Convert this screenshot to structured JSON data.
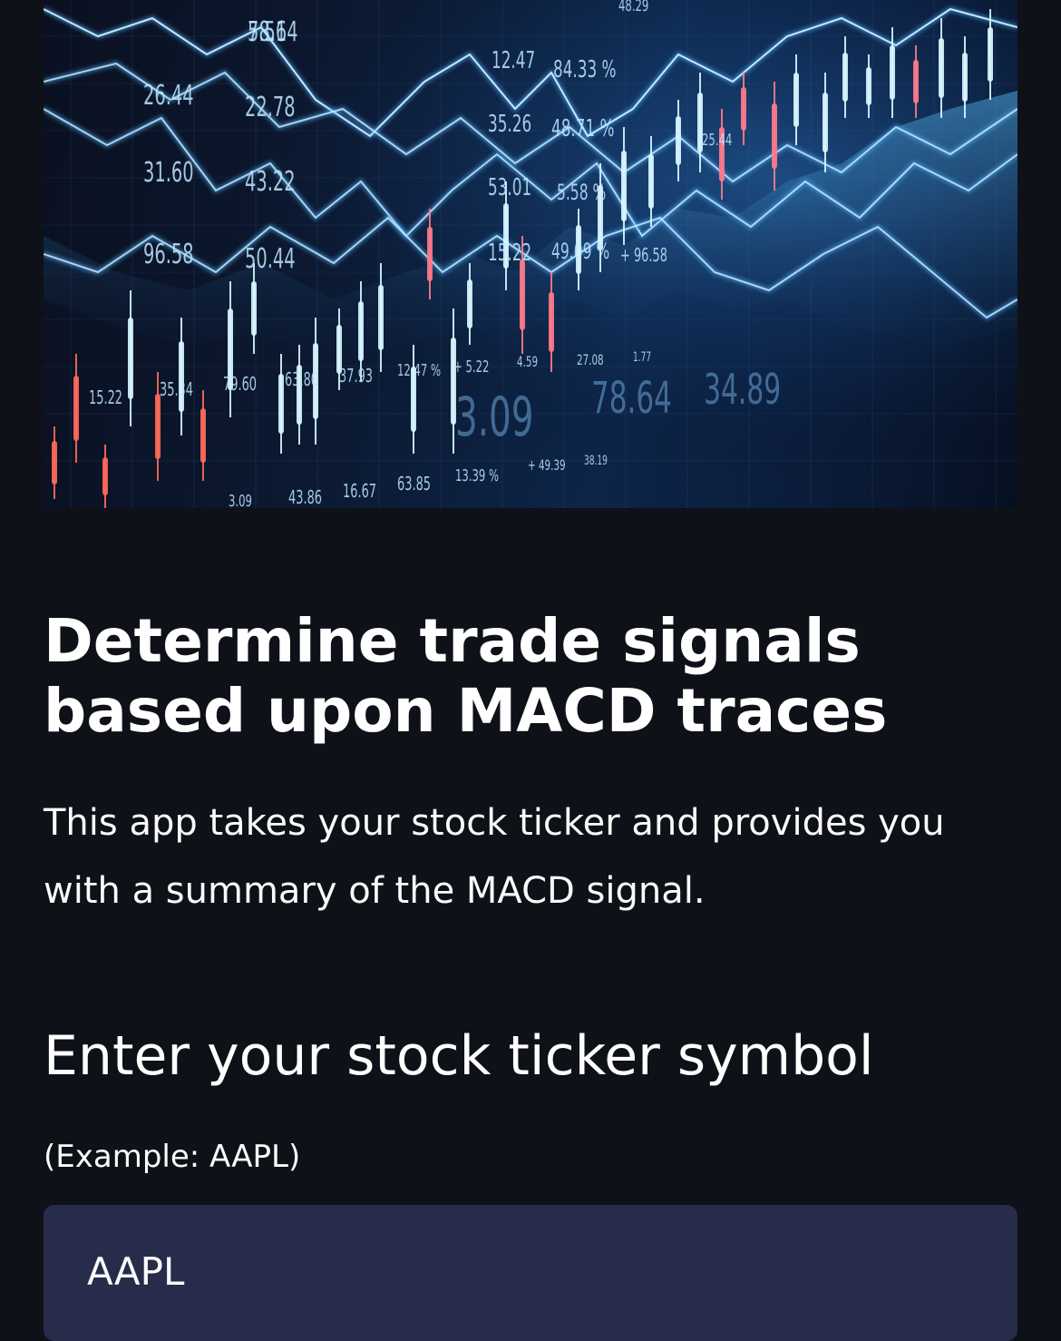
{
  "hero": {
    "image_name": "stock-market-chart-image",
    "labels": [
      "78.64",
      "26.44",
      "22.78",
      "31.60",
      "43.22",
      "96.58",
      "50.44",
      "15.22",
      "35.34",
      "79.60",
      "63.80",
      "37.93",
      "12.47 %",
      "+ 5.22",
      "4.59",
      "27.08",
      "1.77",
      "12.47",
      "84.33 %",
      "35.26",
      "48.71 %",
      "53.01",
      "5.58 %",
      "15.22",
      "49.09 %",
      "+ 96.58",
      "3.09",
      "78.64",
      "34.89",
      "43.86",
      "16.67",
      "63.85",
      "13.39 %",
      "+ 49.39",
      "38.19",
      "3.09",
      "48.29",
      "25.44",
      "5.51"
    ],
    "colors": {
      "line": "#cfefff",
      "glow": "#4fb3ff",
      "bull": "#d8f6ff",
      "bear": "#ff6a5a",
      "pink": "#ff7a8a"
    }
  },
  "content": {
    "title": "Determine trade signals based upon MACD traces",
    "description": "This app takes your stock ticker and provides you with a summary of the MACD signal.",
    "subheader": "Enter your stock ticker symbol",
    "input_label": "(Example: AAPL)",
    "input_value": "AAPL"
  },
  "theme": {
    "background": "#0e1117",
    "input_background": "#262c4a",
    "text": "#fafafa"
  }
}
